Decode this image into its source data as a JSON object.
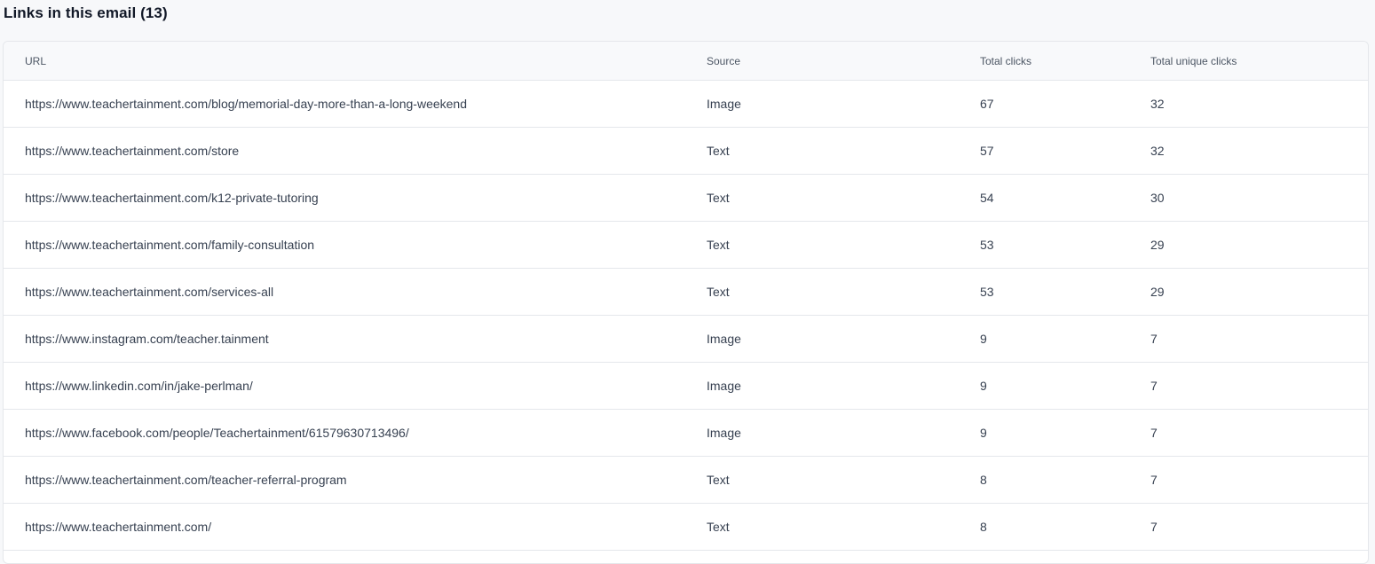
{
  "section": {
    "title": "Links in this email (13)"
  },
  "table": {
    "headers": {
      "url": "URL",
      "source": "Source",
      "total_clicks": "Total clicks",
      "unique_clicks": "Total unique clicks"
    },
    "rows": [
      {
        "url": "https://www.teachertainment.com/blog/memorial-day-more-than-a-long-weekend",
        "source": "Image",
        "total": "67",
        "unique": "32"
      },
      {
        "url": "https://www.teachertainment.com/store",
        "source": "Text",
        "total": "57",
        "unique": "32"
      },
      {
        "url": "https://www.teachertainment.com/k12-private-tutoring",
        "source": "Text",
        "total": "54",
        "unique": "30"
      },
      {
        "url": "https://www.teachertainment.com/family-consultation",
        "source": "Text",
        "total": "53",
        "unique": "29"
      },
      {
        "url": "https://www.teachertainment.com/services-all",
        "source": "Text",
        "total": "53",
        "unique": "29"
      },
      {
        "url": "https://www.instagram.com/teacher.tainment",
        "source": "Image",
        "total": "9",
        "unique": "7"
      },
      {
        "url": "https://www.linkedin.com/in/jake-perlman/",
        "source": "Image",
        "total": "9",
        "unique": "7"
      },
      {
        "url": "https://www.facebook.com/people/Teachertainment/61579630713496/",
        "source": "Image",
        "total": "9",
        "unique": "7"
      },
      {
        "url": "https://www.teachertainment.com/teacher-referral-program",
        "source": "Text",
        "total": "8",
        "unique": "7"
      },
      {
        "url": "https://www.teachertainment.com/",
        "source": "Text",
        "total": "8",
        "unique": "7"
      }
    ]
  }
}
